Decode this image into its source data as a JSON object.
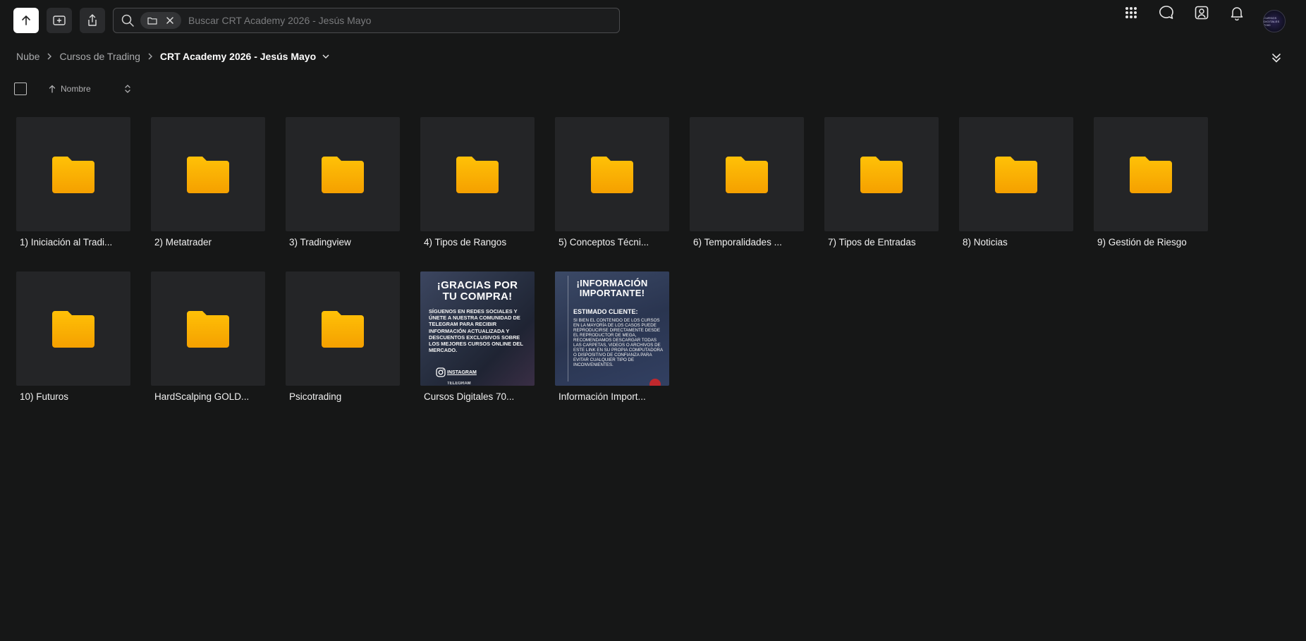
{
  "toolbar": {
    "upload_icon": "upload-arrow-icon",
    "new_folder_icon": "add-folder-icon",
    "share_icon": "share-icon"
  },
  "search": {
    "placeholder": "Buscar CRT Academy 2026 - Jesús Mayo",
    "chip_icon": "folder-icon"
  },
  "header_icons": [
    "apps-grid-icon",
    "chat-icon",
    "contacts-icon",
    "bell-icon"
  ],
  "avatar": {
    "text": "CURSOS DIGITALES 7000"
  },
  "breadcrumb": {
    "items": [
      "Nube",
      "Cursos de Trading"
    ],
    "current": "CRT Academy 2026 - Jesús Mayo"
  },
  "sort": {
    "label": "Nombre",
    "direction": "ascending"
  },
  "items": [
    {
      "name": "1) Iniciación al Tradi...",
      "type": "folder"
    },
    {
      "name": "2) Metatrader",
      "type": "folder"
    },
    {
      "name": "3) Tradingview",
      "type": "folder"
    },
    {
      "name": "4) Tipos de Rangos",
      "type": "folder"
    },
    {
      "name": "5) Conceptos Técni...",
      "type": "folder"
    },
    {
      "name": "6) Temporalidades ...",
      "type": "folder"
    },
    {
      "name": "7) Tipos de Entradas",
      "type": "folder"
    },
    {
      "name": "8) Noticias",
      "type": "folder"
    },
    {
      "name": "9) Gestión de Riesgo",
      "type": "folder"
    },
    {
      "name": "10) Futuros",
      "type": "folder"
    },
    {
      "name": "HardScalping GOLD...",
      "type": "folder"
    },
    {
      "name": "Psicotrading",
      "type": "folder"
    },
    {
      "name": "Cursos Digitales 70...",
      "type": "image"
    },
    {
      "name": "Información Import...",
      "type": "image"
    }
  ],
  "image1": {
    "title_line1": "¡GRACIAS POR",
    "title_line2": "TU COMPRA!",
    "body": "SÍGUENOS EN REDES SOCIALES Y ÚNETE A NUESTRA COMUNIDAD DE TELEGRAM PARA RECIBIR INFORMACIÓN ACTUALIZADA Y DESCUENTOS EXCLUSIVOS SOBRE LOS MEJORES CURSOS ONLINE DEL MERCADO.",
    "social": "INSTAGRAM",
    "social2": "TELEGRAM"
  },
  "image2": {
    "title_line1": "¡INFORMACIÓN",
    "title_line2": "IMPORTANTE!",
    "subtitle": "ESTIMADO CLIENTE:",
    "body": "SI BIEN EL CONTENIDO DE LOS CURSOS EN LA MAYORÍA DE LOS CASOS PUEDE REPRODUCIRSE DIRECTAMENTE DESDE EL REPRODUCTOR DE MEGA, RECOMENDAMOS DESCARGAR TODAS LAS CARPETAS, VIDEOS O ARCHIVOS DE ESTE LINK EN SU PROPIA COMPUTADORA O DISPOSITIVO DE CONFIANZA PARA EVITAR CUALQUIER TIPO DE INCONVENIENTES."
  },
  "colors": {
    "background": "#161717",
    "tile": "#242527",
    "folder_top": "#ffc107",
    "folder_bottom": "#f5a000"
  }
}
